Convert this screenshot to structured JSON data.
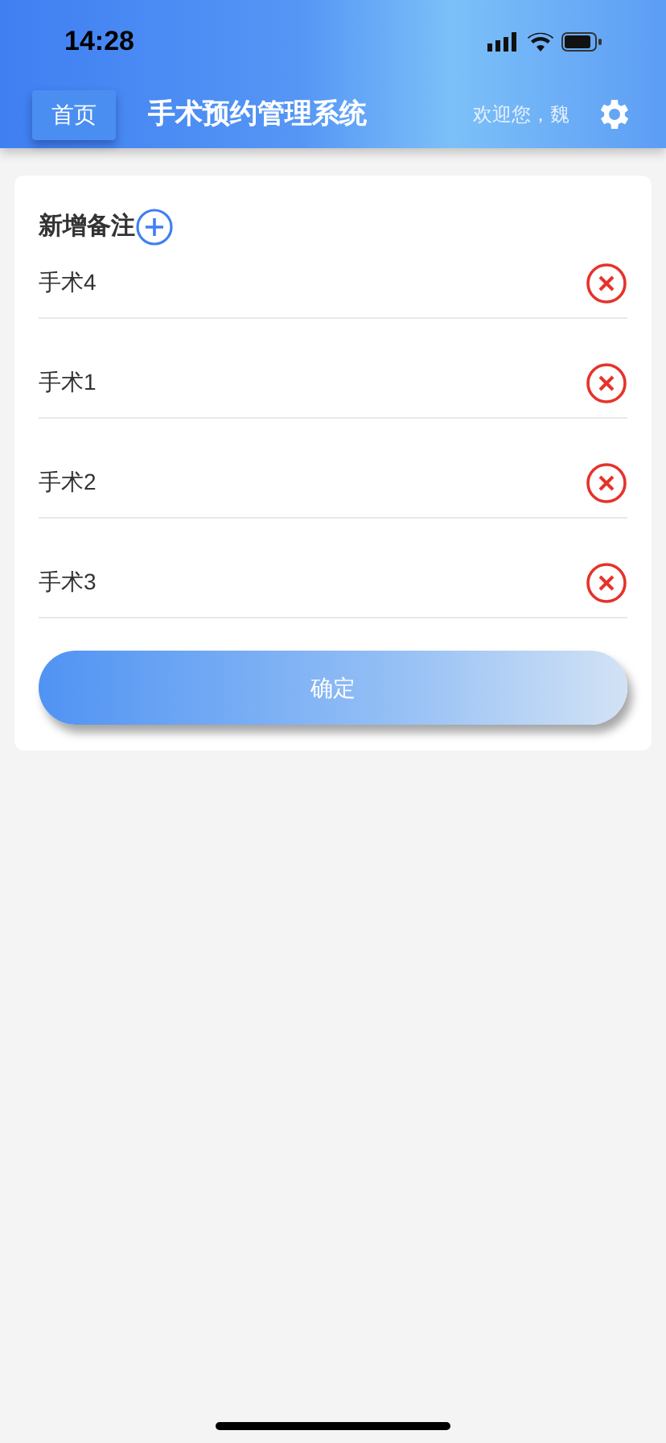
{
  "status_bar": {
    "time": "14:28"
  },
  "header": {
    "home_button": "首页",
    "title": "手术预约管理系统",
    "greeting": "欢迎您，魏"
  },
  "card": {
    "title": "新增备注",
    "notes": [
      {
        "value": "手术4"
      },
      {
        "value": "手术1"
      },
      {
        "value": "手术2"
      },
      {
        "value": "手术3"
      }
    ],
    "confirm_button": "确定"
  }
}
